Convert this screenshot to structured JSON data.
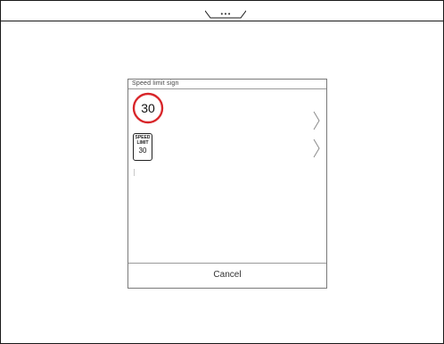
{
  "top_bar": {
    "handle_dots": "•••"
  },
  "dialog": {
    "title": "Speed limit sign",
    "options": [
      {
        "name": "round-sign",
        "value": "30"
      },
      {
        "name": "rectangular-sign",
        "line1": "SPEED",
        "line2": "LIMIT",
        "value": "30"
      }
    ],
    "cancel_label": "Cancel"
  },
  "colors": {
    "round_sign_ring": "#d8262a",
    "frame": "#1a1a1a",
    "dialog_border": "#7a7a7a"
  },
  "icons": {
    "chevron": "chevron-right-icon",
    "handle": "pull-tab-icon"
  }
}
